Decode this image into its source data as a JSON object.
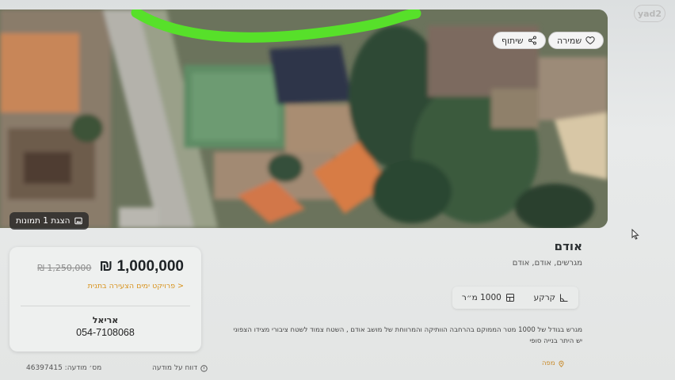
{
  "brand": {
    "logo_text": "yad2"
  },
  "hero": {
    "save_label": "שמירה",
    "share_label": "שיתוף",
    "gallery_label": "הצגת 1 תמונות"
  },
  "listing": {
    "title": "אודם",
    "subtitle": "מגרשים, אודם, אודם",
    "features": [
      {
        "label": "קרקע",
        "icon": "land-icon"
      },
      {
        "label": "1000 מ״ר",
        "icon": "area-icon"
      }
    ],
    "description_lines": [
      "מגרש בגודל של 1000 מטר הממוקם בהרחבה הוותיקה והמרווחת של מושב אודם , השטח צמוד לשטח ציבורי מצידו הצפוני",
      "יש היתר בנייה סופי"
    ],
    "map_label": "מפה"
  },
  "price_card": {
    "price": "₪ 1,000,000",
    "old_price": "₪ 1,250,000",
    "project_link": "פרויקט ימים הצעירה בתנית >",
    "agent_name": "אריאל",
    "agent_phone": "054-7108068"
  },
  "footer": {
    "ad_number": "מס׳ מודעה: 46397415",
    "report_label": "דווח על מודעה"
  },
  "colors": {
    "accent": "#d8931e",
    "highlight_stroke": "#57e02a"
  }
}
